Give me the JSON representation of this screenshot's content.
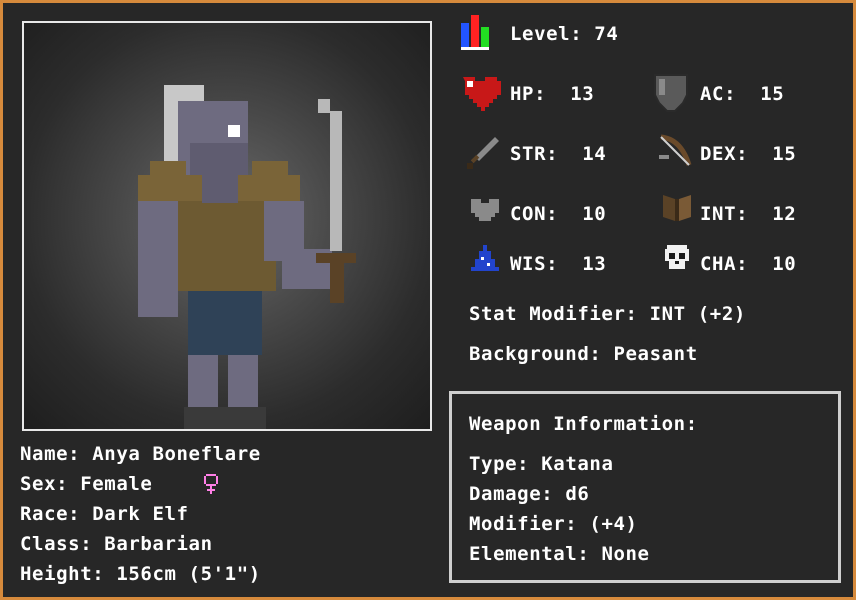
{
  "level": {
    "label": "Level:",
    "value": "74"
  },
  "stats": {
    "hp": {
      "label": "HP:",
      "value": "13"
    },
    "ac": {
      "label": "AC:",
      "value": "15"
    },
    "str": {
      "label": "STR:",
      "value": "14"
    },
    "dex": {
      "label": "DEX:",
      "value": "15"
    },
    "con": {
      "label": "CON:",
      "value": "10"
    },
    "int": {
      "label": "INT:",
      "value": "12"
    },
    "wis": {
      "label": "WIS:",
      "value": "13"
    },
    "cha": {
      "label": "CHA:",
      "value": "10"
    }
  },
  "stat_modifier": {
    "label": "Stat Modifier:",
    "value": "INT (+2)"
  },
  "background": {
    "label": "Background:",
    "value": "Peasant"
  },
  "character": {
    "name": {
      "label": "Name:",
      "value": "Anya Boneflare"
    },
    "sex": {
      "label": "Sex:",
      "value": "Female",
      "icon": "female-symbol-icon"
    },
    "race": {
      "label": "Race:",
      "value": "Dark Elf"
    },
    "class": {
      "label": "Class:",
      "value": "Barbarian"
    },
    "height": {
      "label": "Height:",
      "value": "156cm (5'1\")"
    }
  },
  "weapon": {
    "title": "Weapon Information:",
    "type": {
      "label": "Type:",
      "value": "Katana"
    },
    "damage": {
      "label": "Damage:",
      "value": "d6"
    },
    "modifier": {
      "label": "Modifier:",
      "value": "(+4)"
    },
    "elemental": {
      "label": "Elemental:",
      "value": "None"
    }
  },
  "colors": {
    "frame_border": "#d68a3c",
    "panel_bg": "#272727",
    "text": "#ffffff",
    "female_symbol": "#ff7fe6"
  },
  "icons": [
    "level-bars-icon",
    "heart-icon",
    "shield-icon",
    "sword-icon",
    "bow-icon",
    "shoulder-armor-icon",
    "spellbook-icon",
    "wizard-hat-icon",
    "skull-icon",
    "female-symbol-icon"
  ]
}
